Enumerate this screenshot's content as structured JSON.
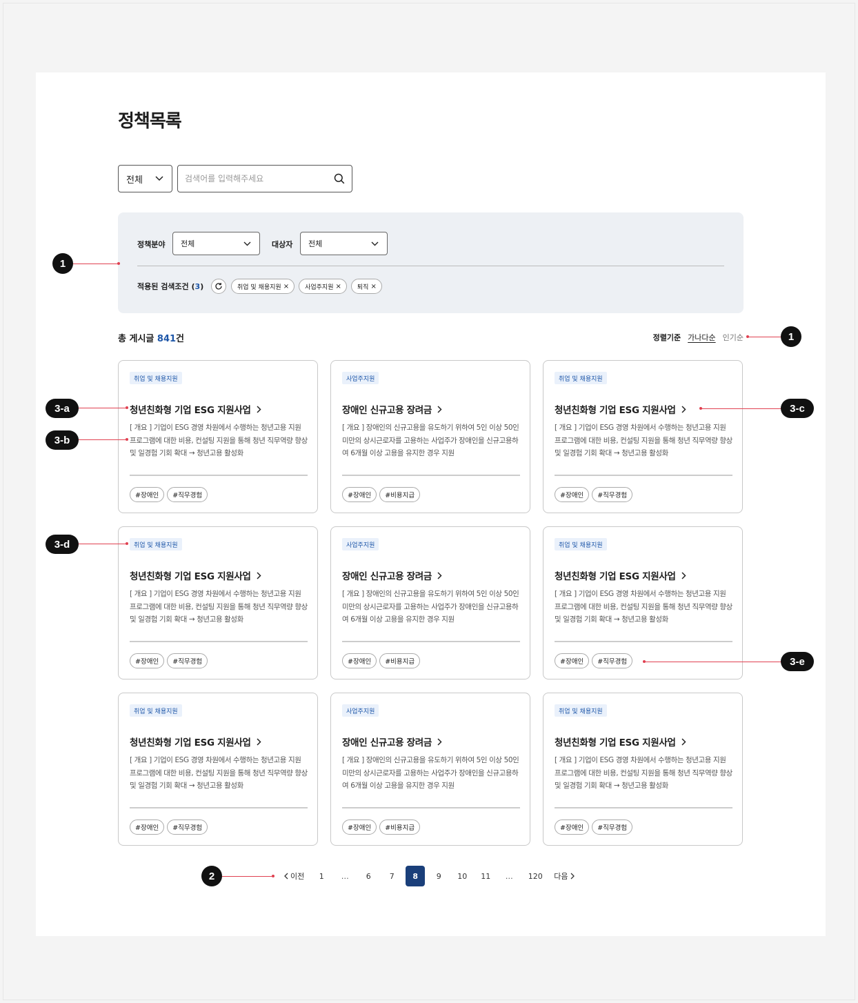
{
  "page_title": "정책목록",
  "search": {
    "scope": "전체",
    "placeholder": "검색어를 입력해주세요",
    "value": ""
  },
  "filter": {
    "field_label": "정책분야",
    "field_value": "전체",
    "target_label": "대상자",
    "target_value": "전체",
    "applied_label": "적용된 검색조건",
    "applied_count": "3",
    "chips": [
      "취업 및 채용지원",
      "사업주지원",
      "퇴직"
    ],
    "chip_close": "×"
  },
  "summary": {
    "total_prefix": "총 게시글",
    "total_count": "841",
    "total_suffix": "건"
  },
  "sort": {
    "label": "정렬기준",
    "active": "가나다순",
    "other": "인기순"
  },
  "cards": [
    {
      "category": "취업 및 채용지원",
      "title": "청년친화형 기업 ESG 지원사업",
      "desc": "[ 개요 ] 기업이 ESG 경영 차원에서 수행하는 청년고용 지원 프로그램에 대한 비용, 컨설팅 지원을 통해 청년 직무역량 향상 및 일경험 기회 확대 → 청년고용 활성화",
      "tags": [
        "#장애인",
        "#직무경험"
      ]
    },
    {
      "category": "사업주지원",
      "title": "장애인 신규고용 장려금",
      "desc": "[ 개요 ] 장애인의 신규고용을 유도하기 위하여 5인 이상 50인 미만의 상시근로자를 고용하는 사업주가 장애인을 신규고용하여 6개월 이상 고용을 유지한 경우 지원",
      "tags": [
        "#장애인",
        "#비용지급"
      ]
    },
    {
      "category": "취업 및 채용지원",
      "title": "청년친화형 기업 ESG 지원사업",
      "desc": "[ 개요 ] 기업이 ESG 경영 차원에서 수행하는 청년고용 지원 프로그램에 대한 비용, 컨설팅 지원을 통해 청년 직무역량 향상 및 일경험 기회 확대 → 청년고용 활성화",
      "tags": [
        "#장애인",
        "#직무경험"
      ]
    },
    {
      "category": "취업 및 채용지원",
      "title": "청년친화형 기업 ESG 지원사업",
      "desc": "[ 개요 ] 기업이 ESG 경영 차원에서 수행하는 청년고용 지원 프로그램에 대한 비용, 컨설팅 지원을 통해 청년 직무역량 향상 및 일경험 기회 확대 → 청년고용 활성화",
      "tags": [
        "#장애인",
        "#직무경험"
      ]
    },
    {
      "category": "사업주지원",
      "title": "장애인 신규고용 장려금",
      "desc": "[ 개요 ] 장애인의 신규고용을 유도하기 위하여 5인 이상 50인 미만의 상시근로자를 고용하는 사업주가 장애인을 신규고용하여 6개월 이상 고용을 유지한 경우 지원",
      "tags": [
        "#장애인",
        "#비용지급"
      ]
    },
    {
      "category": "취업 및 채용지원",
      "title": "청년친화형 기업 ESG 지원사업",
      "desc": "[ 개요 ] 기업이 ESG 경영 차원에서 수행하는 청년고용 지원 프로그램에 대한 비용, 컨설팅 지원을 통해 청년 직무역량 향상 및 일경험 기회 확대 → 청년고용 활성화",
      "tags": [
        "#장애인",
        "#직무경험"
      ]
    },
    {
      "category": "취업 및 채용지원",
      "title": "청년친화형 기업 ESG 지원사업",
      "desc": "[ 개요 ] 기업이 ESG 경영 차원에서 수행하는 청년고용 지원 프로그램에 대한 비용, 컨설팅 지원을 통해 청년 직무역량 향상 및 일경험 기회 확대 → 청년고용 활성화",
      "tags": [
        "#장애인",
        "#직무경험"
      ]
    },
    {
      "category": "사업주지원",
      "title": "장애인 신규고용 장려금",
      "desc": "[ 개요 ] 장애인의 신규고용을 유도하기 위하여 5인 이상 50인 미만의 상시근로자를 고용하는 사업주가 장애인을 신규고용하여 6개월 이상 고용을 유지한 경우 지원",
      "tags": [
        "#장애인",
        "#비용지급"
      ]
    },
    {
      "category": "취업 및 채용지원",
      "title": "청년친화형 기업 ESG 지원사업",
      "desc": "[ 개요 ] 기업이 ESG 경영 차원에서 수행하는 청년고용 지원 프로그램에 대한 비용, 컨설팅 지원을 통해 청년 직무역량 향상 및 일경험 기회 확대 → 청년고용 활성화",
      "tags": [
        "#장애인",
        "#직무경험"
      ]
    }
  ],
  "pagination": {
    "prev": "이전",
    "next": "다음",
    "pages": [
      "1",
      "…",
      "6",
      "7",
      "8",
      "9",
      "10",
      "11",
      "…",
      "120"
    ],
    "current": "8"
  },
  "annotations": {
    "filter_area": "1",
    "sort": "1",
    "pagination": "2",
    "card_title": "3-a",
    "card_desc": "3-b",
    "card_link": "3-c",
    "card_category": "3-d",
    "card_tags": "3-e"
  },
  "colors": {
    "accent": "#1d56a8",
    "pager_current": "#1a3f7a",
    "filter_bg": "#edf0f4",
    "annotation_line": "#e04050"
  }
}
